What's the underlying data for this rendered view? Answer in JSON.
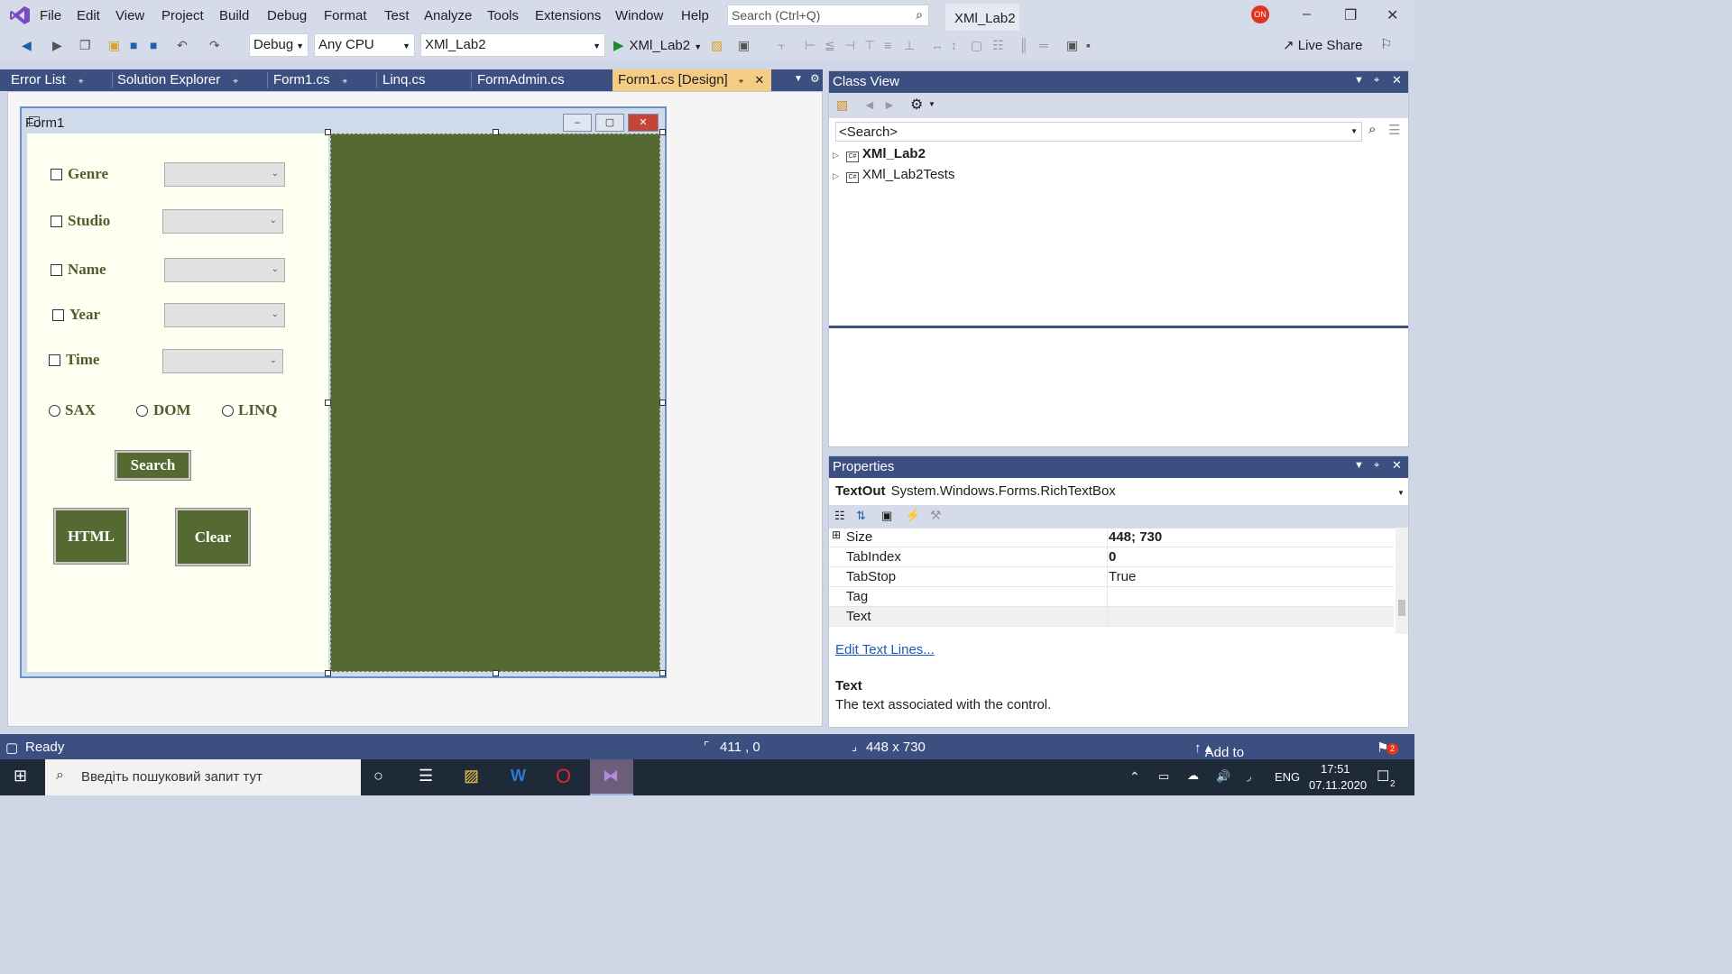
{
  "menubar": {
    "items": [
      "File",
      "Edit",
      "View",
      "Project",
      "Build",
      "Debug",
      "Format",
      "Test",
      "Analyze",
      "Tools",
      "Extensions",
      "Window",
      "Help"
    ],
    "search_placeholder": "Search (Ctrl+Q)",
    "solution_title": "XMl_Lab2",
    "user_badge": "ON"
  },
  "toolbar": {
    "config": "Debug",
    "platform": "Any CPU",
    "startup_project": "XMl_Lab2",
    "run_target": "XMl_Lab2",
    "live_share": "Live Share"
  },
  "tabs": [
    {
      "label": "Error List",
      "pinned": true
    },
    {
      "label": "Solution Explorer",
      "pinned": true
    },
    {
      "label": "Form1.cs",
      "pinned": true
    },
    {
      "label": "Linq.cs",
      "pinned": false
    },
    {
      "label": "FormAdmin.cs",
      "pinned": false
    },
    {
      "label": "Form1.cs [Design]",
      "pinned": true,
      "active": true
    }
  ],
  "form": {
    "title": "Form1",
    "checks": [
      "Genre",
      "Studio",
      "Name",
      "Year",
      "Time"
    ],
    "radios": [
      "SAX",
      "DOM",
      "LINQ"
    ],
    "buttons": {
      "search": "Search",
      "html": "HTML",
      "clear": "Clear"
    },
    "colors": {
      "background": "#fdfff0",
      "accent": "#546a32"
    }
  },
  "classview": {
    "title": "Class View",
    "search": "<Search>",
    "nodes": [
      {
        "label": "XMl_Lab2",
        "bold": true
      },
      {
        "label": "XMl_Lab2Tests",
        "bold": false
      }
    ]
  },
  "properties": {
    "title": "Properties",
    "object_name": "TextOut",
    "object_type": "System.Windows.Forms.RichTextBox",
    "rows": [
      {
        "name": "Size",
        "value": "448; 730"
      },
      {
        "name": "TabIndex",
        "value": "0"
      },
      {
        "name": "TabStop",
        "value": "True"
      },
      {
        "name": "Tag",
        "value": ""
      },
      {
        "name": "Text",
        "value": ""
      }
    ],
    "edit_link": "Edit Text Lines...",
    "desc_title": "Text",
    "desc_text": "The text associated with the control."
  },
  "statusbar": {
    "status": "Ready",
    "position": "411 , 0",
    "size": "448 x 730",
    "source_control": "Add to Source Control",
    "notifications": "2"
  },
  "taskbar": {
    "search_placeholder": "Введіть пошуковий запит тут",
    "lang": "ENG",
    "time": "17:51",
    "date": "07.11.2020",
    "notif_count": "2"
  }
}
